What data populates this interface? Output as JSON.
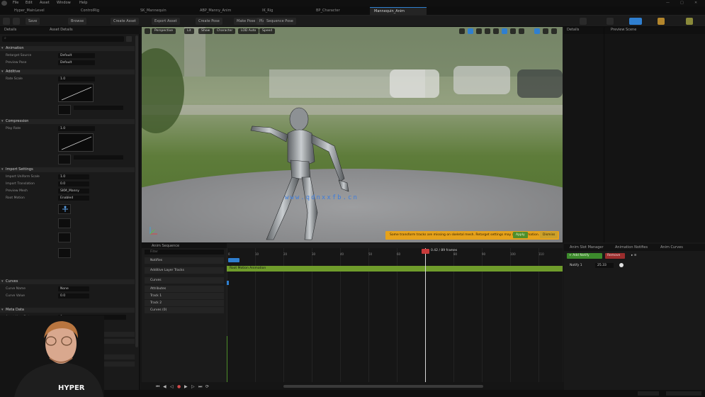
{
  "menubar": {
    "items": [
      "File",
      "Edit",
      "Asset",
      "Window",
      "Help"
    ]
  },
  "tabs": [
    {
      "label": "Hyper_MainLevel",
      "active": false
    },
    {
      "label": "ControlRig",
      "active": false
    },
    {
      "label": "SK_Mannequin",
      "active": false
    },
    {
      "label": "ABP_Manny_Anim",
      "active": false
    },
    {
      "label": "IK_Rig",
      "active": false
    },
    {
      "label": "BP_Character",
      "active": false
    },
    {
      "label": "Mannequin_Anim",
      "active": true
    }
  ],
  "toolbar": {
    "buttons": [
      "Save",
      "Browse",
      "Create Asset",
      "Export Asset",
      "Create Pose",
      "Make Pose",
      "Play",
      "Sequence Pose"
    ]
  },
  "left_panel": {
    "tabs": [
      "Details",
      "Asset Details"
    ],
    "sections": [
      {
        "label": "Animation",
        "rows": [
          {
            "label": "Retarget Source",
            "value": "Default"
          },
          {
            "label": "Preview Pose",
            "value": "Default"
          }
        ]
      },
      {
        "label": "Additive",
        "rows": [
          {
            "label": "Rate Scale",
            "value": "1.0"
          }
        ]
      },
      {
        "label": "Compression",
        "rows": [
          {
            "label": "Play Rate",
            "value": "1.0"
          }
        ]
      },
      {
        "label": "Import Settings",
        "rows": [
          {
            "label": "Import Uniform Scale",
            "value": "1.0"
          },
          {
            "label": "Import Translation",
            "value": "0.0"
          },
          {
            "label": "Preview Mesh",
            "value": "SKM_Manny"
          },
          {
            "label": "Root Motion",
            "value": "Enabled"
          }
        ]
      },
      {
        "label": "Curves",
        "rows": [
          {
            "label": "Curve Name",
            "value": "None"
          },
          {
            "label": "Curve Value",
            "value": "0.0"
          }
        ]
      },
      {
        "label": "Meta Data",
        "rows": [
          {
            "label": "Asset User Data",
            "value": "0"
          }
        ]
      }
    ],
    "search_placeholder": "Search"
  },
  "viewport": {
    "buttons": [
      "Perspective",
      "Lit",
      "Show",
      "Character",
      "LOD Auto",
      "Speed"
    ],
    "notification": "Some transform tracks are missing on skeletal mesh. Retarget settings may affect animation.",
    "notif_apply": "Apply",
    "notif_dismiss": "Dismiss"
  },
  "watermark": "www.qdnxxfb.cn",
  "right_panel": {
    "tabs": [
      "Details",
      "Preview Scene"
    ]
  },
  "sequencer": {
    "tab": "Anim Sequence",
    "filter_label": "Filter",
    "tracks": [
      "Notifies",
      "Additive Layer Tracks",
      "Curves",
      "Attributes",
      "Track 1",
      "Track 2",
      "Curves (0)"
    ],
    "green_track": "Root Motion Animation",
    "ticks": [
      "0",
      "10",
      "20",
      "30",
      "40",
      "50",
      "60",
      "70",
      "80",
      "90",
      "100",
      "110",
      "120"
    ],
    "playhead_label": "0.42 / 89 frames"
  },
  "detail_panel": {
    "tabs": [
      "Anim Slot Manager",
      "Animation Notifies",
      "Anim Curves"
    ],
    "add_button": "+ Add Notify",
    "remove_button": "Remove",
    "track_label": "Notify 1",
    "track_value": "25.33"
  },
  "webcam": {
    "shirt_text": "HYPER"
  },
  "colors": {
    "accent": "#2f7fd0",
    "green_track": "#6f9c2b",
    "notification": "#e6a21b",
    "watermark": "#3f7ddb"
  }
}
